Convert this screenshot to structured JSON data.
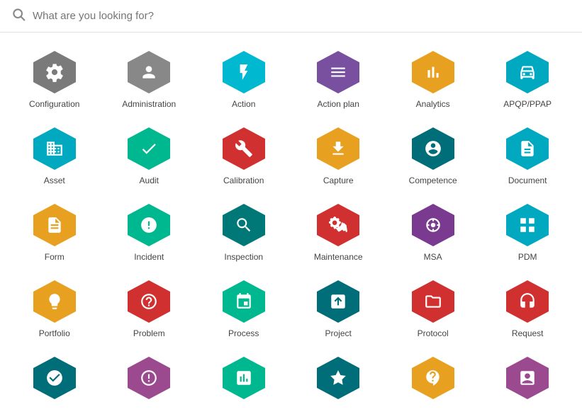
{
  "search": {
    "placeholder": "What are you looking for?"
  },
  "icons": [
    {
      "id": "configuration",
      "label": "Configuration",
      "color": "#7a7a7a",
      "symbol": "⚙",
      "row": 1
    },
    {
      "id": "administration",
      "label": "Administration",
      "color": "#888",
      "symbol": "👤",
      "row": 1
    },
    {
      "id": "action",
      "label": "Action",
      "color": "#00b0c8",
      "symbol": "⚡",
      "row": 1
    },
    {
      "id": "action-plan",
      "label": "Action plan",
      "color": "#6b52a0",
      "symbol": "☰",
      "row": 1
    },
    {
      "id": "analytics",
      "label": "Analytics",
      "color": "#e8a020",
      "symbol": "📊",
      "row": 1
    },
    {
      "id": "apqp-ppap",
      "label": "APQP/PPAP",
      "color": "#00a0c0",
      "symbol": "🚗",
      "row": 1
    },
    {
      "id": "asset",
      "label": "Asset",
      "color": "#00a0c0",
      "symbol": "🏢",
      "row": 2
    },
    {
      "id": "audit",
      "label": "Audit",
      "color": "#00b890",
      "symbol": "✔",
      "row": 2
    },
    {
      "id": "calibration",
      "label": "Calibration",
      "color": "#e04040",
      "symbol": "🔧",
      "row": 2
    },
    {
      "id": "capture",
      "label": "Capture",
      "color": "#e8a020",
      "symbol": "⬇",
      "row": 2
    },
    {
      "id": "competence",
      "label": "Competence",
      "color": "#007878",
      "symbol": "👤",
      "row": 2
    },
    {
      "id": "document",
      "label": "Document",
      "color": "#00a8c0",
      "symbol": "📄",
      "row": 2
    },
    {
      "id": "form",
      "label": "Form",
      "color": "#e8a020",
      "symbol": "📋",
      "row": 3
    },
    {
      "id": "incident",
      "label": "Incident",
      "color": "#00b890",
      "symbol": "⛑",
      "row": 3
    },
    {
      "id": "inspection",
      "label": "Inspection",
      "color": "#007878",
      "symbol": "🔍",
      "row": 3
    },
    {
      "id": "maintenance",
      "label": "Maintenance",
      "color": "#e04040",
      "symbol": "🔨",
      "row": 3
    },
    {
      "id": "msa",
      "label": "MSA",
      "color": "#7a3a90",
      "symbol": "⊙",
      "row": 3
    },
    {
      "id": "pdm",
      "label": "PDM",
      "color": "#00a8c0",
      "symbol": "⊞",
      "row": 3
    },
    {
      "id": "portfolio",
      "label": "Portfolio",
      "color": "#e8a020",
      "symbol": "💡",
      "row": 4
    },
    {
      "id": "problem",
      "label": "Problem",
      "color": "#e04040",
      "symbol": "?",
      "row": 4
    },
    {
      "id": "process",
      "label": "Process",
      "color": "#00b890",
      "symbol": "⬡",
      "row": 4
    },
    {
      "id": "project",
      "label": "Project",
      "color": "#007878",
      "symbol": "⇥",
      "row": 4
    },
    {
      "id": "protocol",
      "label": "Protocol",
      "color": "#e04040",
      "symbol": "📁",
      "row": 4
    },
    {
      "id": "request",
      "label": "Request",
      "color": "#e04040",
      "symbol": "🎧",
      "row": 4
    },
    {
      "id": "icon-r5-1",
      "label": "",
      "color": "#007878",
      "symbol": "",
      "row": 5
    },
    {
      "id": "icon-r5-2",
      "label": "",
      "color": "#9c4a90",
      "symbol": "",
      "row": 5
    },
    {
      "id": "icon-r5-3",
      "label": "",
      "color": "#00b890",
      "symbol": "",
      "row": 5
    },
    {
      "id": "icon-r5-4",
      "label": "",
      "color": "#007878",
      "symbol": "",
      "row": 5
    },
    {
      "id": "icon-r5-5",
      "label": "",
      "color": "#e8a020",
      "symbol": "",
      "row": 5
    },
    {
      "id": "icon-r5-6",
      "label": "",
      "color": "#9c4a90",
      "symbol": "",
      "row": 5
    }
  ],
  "colors": {
    "gray": "#888888",
    "teal": "#00b0c8",
    "purple": "#6b52a0",
    "orange": "#e8a020",
    "blue_teal": "#00a0c0",
    "green_teal": "#00b890",
    "red": "#e04040",
    "dark_teal": "#007878"
  }
}
